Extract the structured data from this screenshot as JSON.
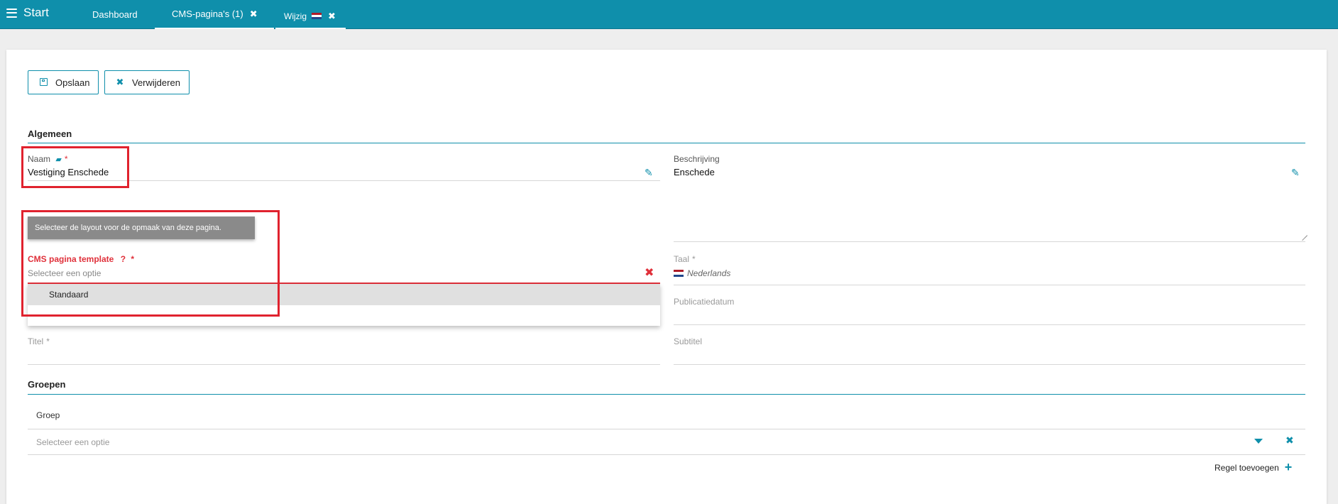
{
  "topbar": {
    "start_label": "Start",
    "tabs": [
      {
        "label": "Dashboard"
      },
      {
        "label": "CMS-pagina's (1)",
        "close": "✖"
      },
      {
        "label": "Wijzig",
        "close": "✖"
      }
    ]
  },
  "toolbar": {
    "save_label": "Opslaan",
    "delete_label": "Verwijderen",
    "delete_icon": "✖"
  },
  "general": {
    "title": "Algemeen",
    "name_label": "Naam",
    "name_value": "Vestiging Enschede",
    "description_label": "Beschrijving",
    "description_value": "Enschede",
    "tooltip": "Selecteer de layout voor de opmaak van deze pagina.",
    "template_label": "CMS pagina template",
    "template_help": "?",
    "template_placeholder": "Selecteer een optie",
    "template_options": [
      "Standaard"
    ],
    "language_label": "Taal",
    "language_value": "Nederlands",
    "publication_date_label": "Publicatiedatum",
    "title_label": "Titel",
    "subtitle_label": "Subtitel",
    "required_marker": "*",
    "pencil_icon": "✎",
    "clear_icon": "✖"
  },
  "groups": {
    "title": "Groepen",
    "column_header": "Groep",
    "select_placeholder": "Selecteer een optie",
    "remove_icon": "✖",
    "add_row_label": "Regel toevoegen",
    "add_icon": "+"
  },
  "colors": {
    "accent": "#0f8fab",
    "error": "#e0303a",
    "highlight": "#e0222e"
  }
}
